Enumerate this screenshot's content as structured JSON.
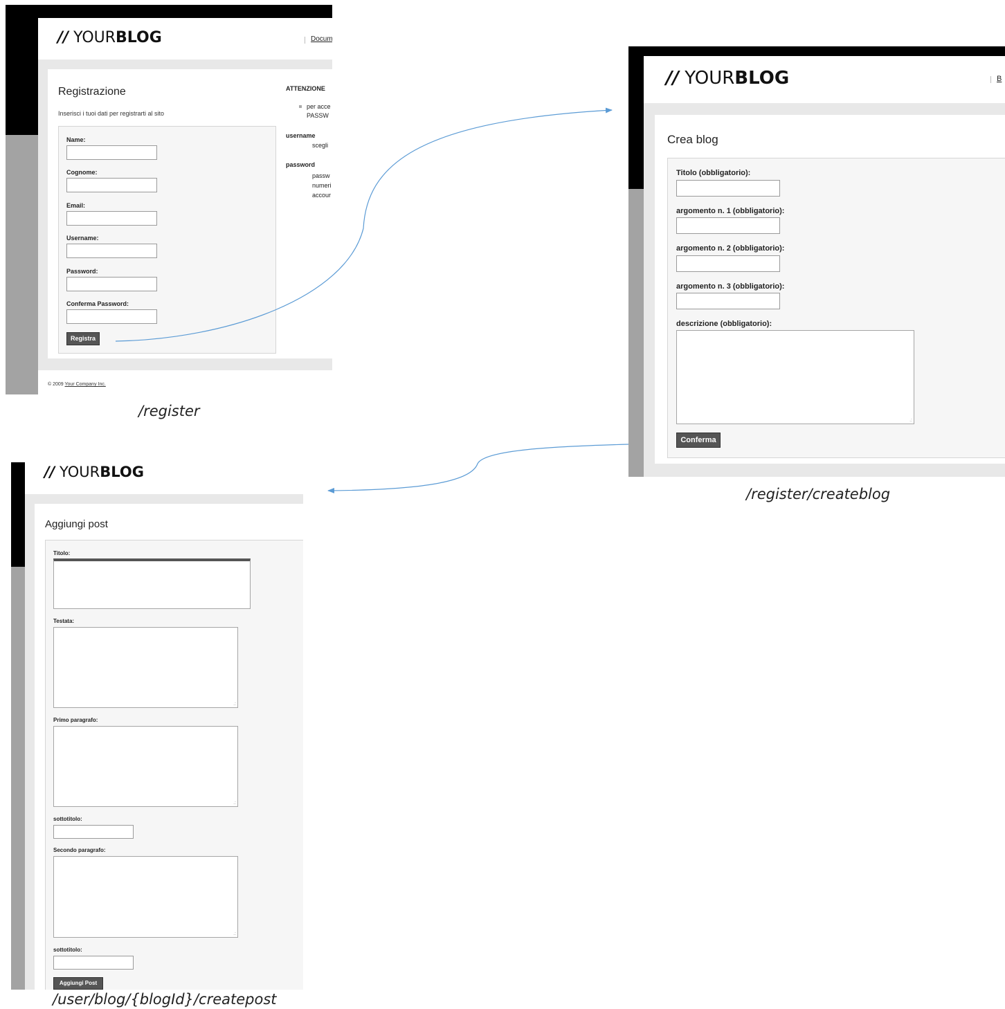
{
  "logo": {
    "slash": "//",
    "your": "YOUR",
    "blog": "BLOG"
  },
  "register": {
    "nav_link": "Docum",
    "title": "Registrazione",
    "intro": "Inserisci i tuoi dati per registrarti al sito",
    "fields": [
      "Name:",
      "Cognome:",
      "Email:",
      "Username:",
      "Password:",
      "Conferma Password:"
    ],
    "submit_label": "Registra",
    "sidebar": {
      "heading": "ATTENZIONE",
      "bullet_line1": "per acce",
      "bullet_line2": "PASSW",
      "username_label": "username",
      "username_text": "scegli",
      "password_label": "password",
      "password_line1": "passw",
      "password_line2": "numeri",
      "password_line3": "accour"
    },
    "footer_prefix": "© 2009",
    "footer_link": "Your Company Inc.",
    "caption": "/register"
  },
  "createblog": {
    "nav_link": "B",
    "title": "Crea blog",
    "fields": [
      "Titolo (obbligatorio):",
      "argomento n. 1 (obbligatorio):",
      "argomento n. 2 (obbligatorio):",
      "argomento n. 3 (obbligatorio):"
    ],
    "description_label": "descrizione (obbligatorio):",
    "submit_label": "Conferma",
    "caption": "/register/createblog"
  },
  "createpost": {
    "title": "Aggiungi post",
    "titolo_label": "Titolo:",
    "testata_label": "Testata:",
    "primo_label": "Primo paragrafo:",
    "sottotitolo1_label": "sottotitolo:",
    "secondo_label": "Secondo paragrafo:",
    "sottotitolo2_label": "sottotitolo:",
    "submit_label": "Aggiungi Post",
    "caption": "/user/blog/{blogId}/createpost"
  },
  "colors": {
    "arrow": "#5b9bd5",
    "button": "#555555",
    "band": "#e8e8e8"
  }
}
